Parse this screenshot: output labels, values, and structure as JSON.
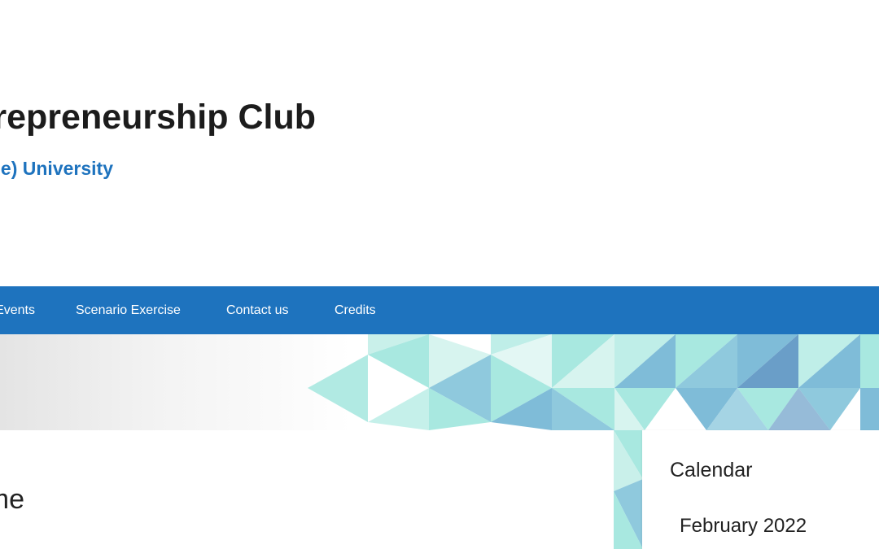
{
  "header": {
    "site_title": "Entrepreneurship Club",
    "site_subtitle": "Jain (Deemed-to-be) University"
  },
  "nav": {
    "items": [
      {
        "label": "Events"
      },
      {
        "label": "Scenario Exercise"
      },
      {
        "label": "Contact us"
      },
      {
        "label": "Credits"
      }
    ]
  },
  "main": {
    "entry_title": "Welcome"
  },
  "sidebar": {
    "widget_title": "Calendar",
    "calendar_caption": "February 2022"
  },
  "colors": {
    "accent": "#1e73be",
    "text": "#222222",
    "banner_teal": "#a8e8e0",
    "banner_blue": "#6a9ec8"
  }
}
